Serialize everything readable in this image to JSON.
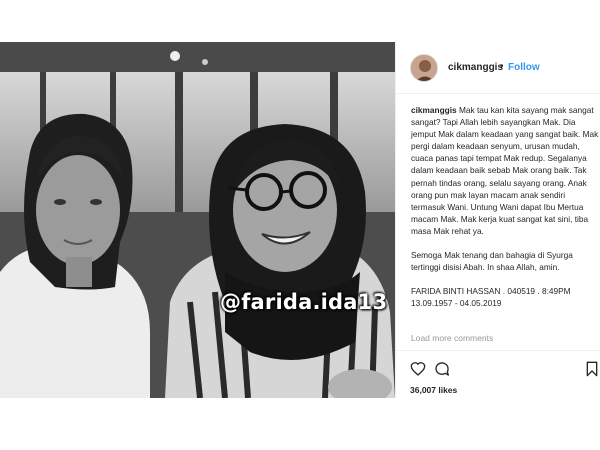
{
  "post": {
    "watermark": "@farida.ida13",
    "username": "cikmanggis",
    "separator": "•",
    "follow_label": "Follow",
    "caption": {
      "username": "cikmanggis",
      "paragraph1": "Mak tau kan kita sayang mak sangat sangat? Tapi Allah lebih sayangkan Mak. Dia jemput Mak dalam keadaan yang sangat baik. Mak pergi dalam keadaan senyum, urusan mudah, cuaca panas tapi tempat Mak redup. Segalanya dalam keadaan baik sebab Mak orang baik. Tak pernah tindas orang, selalu sayang orang. Anak orang pun mak layan macam anak sendiri termasuk Wani. Untung Wani dapat Ibu Mertua macam Mak. Mak kerja kuat sangat kat sini, tiba masa Mak rehat ya.",
      "paragraph2": "Semoga Mak tenang dan bahagia di Syurga tertinggi disisi Abah. In shaa Allah, amin.",
      "paragraph3": "FARIDA BINTI HASSAN . 040519 . 8:49PM\n13.09.1957 - 04.05.2019"
    },
    "load_more_label": "Load more comments",
    "likes": "36,007 likes",
    "icons": {
      "like": "heart-icon",
      "comment": "comment-icon",
      "save": "bookmark-icon",
      "avatar": "profile-avatar"
    },
    "colors": {
      "follow": "#3897f0",
      "text": "#262626",
      "muted": "#999999",
      "border": "#efefef"
    }
  }
}
